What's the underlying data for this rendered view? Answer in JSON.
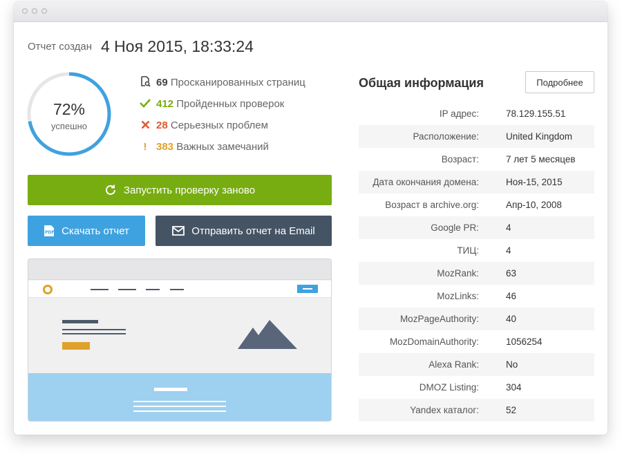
{
  "report": {
    "created_label": "Отчет создан",
    "created_date": "4 Ноя 2015, 18:33:24"
  },
  "score": {
    "percent": 72,
    "percent_text": "72%",
    "label": "успешно"
  },
  "stats": [
    {
      "icon": "search-page-icon",
      "count": "69",
      "label": "Просканированных страниц",
      "color": "#444444"
    },
    {
      "icon": "check-icon",
      "count": "412",
      "label": "Пройденных проверок",
      "color": "#77ad11"
    },
    {
      "icon": "cross-icon",
      "count": "28",
      "label": "Серьезных проблем",
      "color": "#e2582c"
    },
    {
      "icon": "exclamation-icon",
      "count": "383",
      "label": "Важных замечаний",
      "color": "#e0a12a"
    }
  ],
  "actions": {
    "rerun_label": "Запустить проверку заново",
    "download_label": "Скачать отчет",
    "email_label": "Отправить отчет на Email"
  },
  "info": {
    "title": "Общая информация",
    "details_label": "Подробнее",
    "rows": [
      {
        "key": "IP адрес:",
        "value": "78.129.155.51"
      },
      {
        "key": "Расположение:",
        "value": "United Kingdom"
      },
      {
        "key": "Возраст:",
        "value": "7 лет 5 месяцев"
      },
      {
        "key": "Дата окончания домена:",
        "value": "Ноя-15, 2015"
      },
      {
        "key": "Возраст в archive.org:",
        "value": "Апр-10, 2008"
      },
      {
        "key": "Google PR:",
        "value": "4"
      },
      {
        "key": "ТИЦ:",
        "value": "4"
      },
      {
        "key": "MozRank:",
        "value": "63"
      },
      {
        "key": "MozLinks:",
        "value": "46"
      },
      {
        "key": "MozPageAuthority:",
        "value": "40"
      },
      {
        "key": "MozDomainAuthority:",
        "value": "1056254"
      },
      {
        "key": "Alexa Rank:",
        "value": "No"
      },
      {
        "key": "DMOZ Listing:",
        "value": "304"
      },
      {
        "key": "Yandex каталог:",
        "value": "52"
      }
    ]
  },
  "colors": {
    "accent_blue": "#3fa2e0",
    "green": "#77ad11",
    "dark": "#455464",
    "orange": "#e0a12a",
    "red": "#e2582c"
  }
}
